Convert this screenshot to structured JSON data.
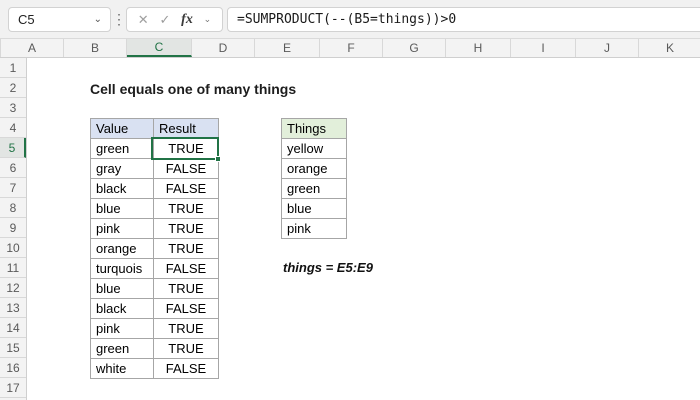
{
  "formula_bar": {
    "name_box_value": "C5",
    "name_box_chevron": "⌄",
    "menu_dots": "⋮",
    "cancel_label": "✕",
    "enter_label": "✓",
    "fx_label": "fx",
    "fx_chevron": "⌄",
    "formula": "=SUMPRODUCT(--(B5=things))>0"
  },
  "grid": {
    "column_headers": [
      "A",
      "B",
      "C",
      "D",
      "E",
      "F",
      "G",
      "H",
      "I",
      "J",
      "K"
    ],
    "row_headers": [
      "1",
      "2",
      "3",
      "4",
      "5",
      "6",
      "7",
      "8",
      "9",
      "10",
      "11",
      "12",
      "13",
      "14",
      "15",
      "16",
      "17"
    ],
    "selected_column": "C",
    "selected_row": "5"
  },
  "sheet": {
    "title": "Cell equals one of many things",
    "note": "things = E5:E9",
    "selected_cell": {
      "ref": "C5",
      "value": "TRUE"
    },
    "value_table": {
      "headers": [
        "Value",
        "Result"
      ],
      "rows": [
        [
          "green",
          "TRUE"
        ],
        [
          "gray",
          "FALSE"
        ],
        [
          "black",
          "FALSE"
        ],
        [
          "blue",
          "TRUE"
        ],
        [
          "pink",
          "TRUE"
        ],
        [
          "orange",
          "TRUE"
        ],
        [
          "turquois",
          "FALSE"
        ],
        [
          "blue",
          "TRUE"
        ],
        [
          "black",
          "FALSE"
        ],
        [
          "pink",
          "TRUE"
        ],
        [
          "green",
          "TRUE"
        ],
        [
          "white",
          "FALSE"
        ]
      ]
    },
    "things_table": {
      "header": "Things",
      "rows": [
        "yellow",
        "orange",
        "green",
        "blue",
        "pink"
      ]
    }
  },
  "colors": {
    "accent_green": "#217346",
    "value_header_fill": "#D9E1F2",
    "things_header_fill": "#E2EFDA",
    "header_bar_fill": "#F3F3F3"
  }
}
